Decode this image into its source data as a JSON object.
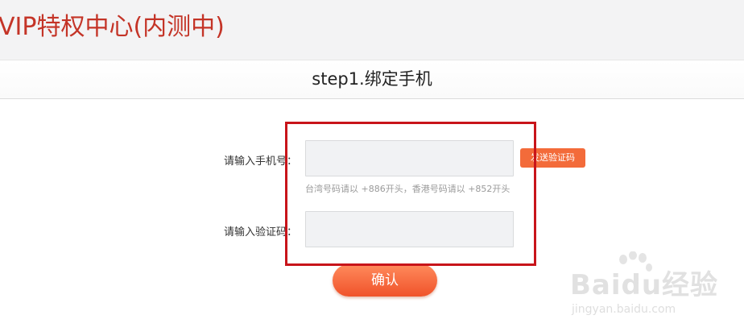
{
  "header": {
    "title": "VIP特权中心(内测中)"
  },
  "step": {
    "title": "step1.绑定手机"
  },
  "form": {
    "phone_label": "请输入手机号：",
    "phone_value": "",
    "phone_hint": "台湾号码请以 +886开头，香港号码请以 +852开头",
    "send_code_label": "发送验证码",
    "code_label": "请输入验证码：",
    "code_value": "",
    "confirm_label": "确认"
  },
  "watermark": {
    "brand": "Baidu经验",
    "url": "jingyan.baidu.com"
  },
  "colors": {
    "title_red": "#c43427",
    "button_orange": "#f36b3a",
    "annotation_red": "#c8141a"
  }
}
